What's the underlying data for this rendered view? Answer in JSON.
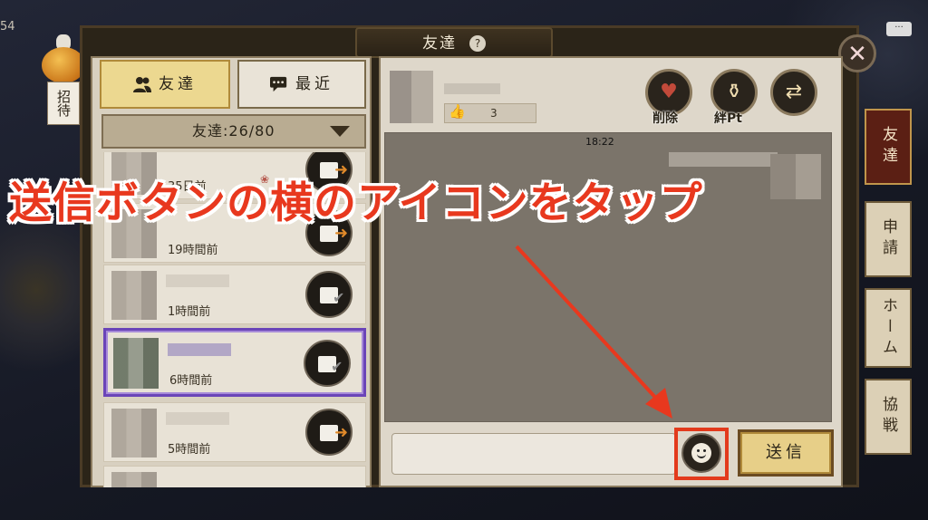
{
  "corner": {
    "number": "54",
    "chat_icon_text": "···"
  },
  "invite": {
    "label": "招待"
  },
  "window": {
    "title": "友達",
    "help_glyph": "?",
    "close_glyph": "✕"
  },
  "tabs": {
    "friends_label": "友達",
    "recent_label": "最近"
  },
  "friends_dropdown": {
    "label": "友達:26/80"
  },
  "friend_list": [
    {
      "time": "35日前",
      "action": "send",
      "selected": false
    },
    {
      "time": "19時間前",
      "action": "send",
      "selected": false
    },
    {
      "time": "1時間前",
      "action": "received",
      "selected": false
    },
    {
      "time": "6時間前",
      "action": "received",
      "selected": true
    },
    {
      "time": "5時間前",
      "action": "send",
      "selected": false
    }
  ],
  "friend_detail": {
    "like_count": "3",
    "delete_label": "削除",
    "bond_label": "絆Pt"
  },
  "chat": {
    "time": "18:22",
    "send_label": "送信"
  },
  "side_tabs": [
    "友達",
    "申請",
    "ホーム",
    "協戦"
  ],
  "overlay": {
    "caption": "送信ボタンの横のアイコンをタップ",
    "accent": "#e8381e"
  },
  "icons": {
    "friends_tab": "people-icon",
    "recent_tab": "chat-bubble-icon",
    "delete": "broken-heart-icon",
    "bond": "bottle-icon",
    "swap": "swap-arrows-icon",
    "emoji": "smiley-face-icon"
  }
}
